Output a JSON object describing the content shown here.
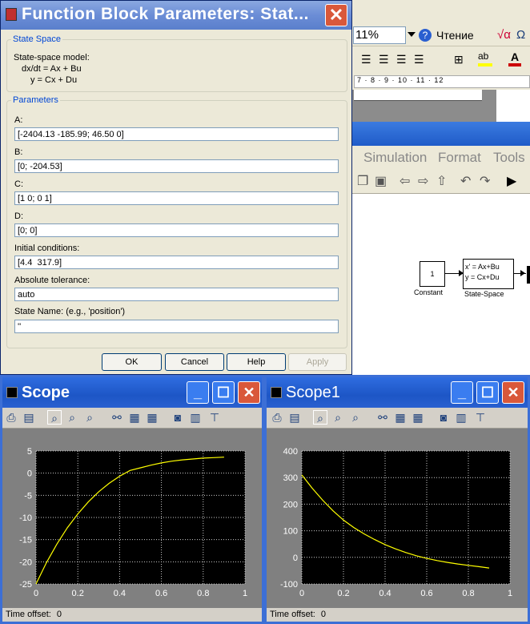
{
  "word": {
    "zoom_value": "11%",
    "reading_label": "Чтение",
    "ruler": "7 · 8 · 9 · 10 · 11 · 12"
  },
  "simulink": {
    "menu": [
      "Simulation",
      "Format",
      "Tools"
    ],
    "constant_block_value": "1",
    "constant_block_label": "Constant",
    "ss_block_line1": "x' = Ax+Bu",
    "ss_block_line2": "y = Cx+Du",
    "ss_block_label": "State-Space"
  },
  "dialog": {
    "title": "Function Block Parameters: Stat...",
    "close_glyph": "✕",
    "state_space_group": "State Space",
    "description": [
      "State-space model:",
      "dx/dt = Ax + Bu",
      "y = Cx + Du"
    ],
    "parameters_group": "Parameters",
    "fields": [
      {
        "label": "A:",
        "value": "[-2404.13 -185.99; 46.50 0]"
      },
      {
        "label": "B:",
        "value": "[0; -204.53]"
      },
      {
        "label": "C:",
        "value": "[1 0; 0 1]"
      },
      {
        "label": "D:",
        "value": "[0; 0]"
      },
      {
        "label": "Initial conditions:",
        "value": "[4.4  317.9]"
      },
      {
        "label": "Absolute tolerance:",
        "value": "auto"
      },
      {
        "label": "State Name: (e.g., 'position')",
        "value": "''"
      }
    ],
    "buttons": {
      "ok": "OK",
      "cancel": "Cancel",
      "help": "Help",
      "apply": "Apply"
    }
  },
  "scopes": [
    {
      "title": "Scope",
      "time_offset_label": "Time offset:",
      "time_offset_value": "0",
      "minimize_glyph": "_",
      "maximize_glyph": "☐",
      "close_glyph": "✕"
    },
    {
      "title": "Scope1",
      "time_offset_label": "Time offset:",
      "time_offset_value": "0",
      "minimize_glyph": "_",
      "maximize_glyph": "☐",
      "close_glyph": "✕"
    }
  ],
  "chart_data": [
    {
      "type": "line",
      "xlim": [
        0,
        1
      ],
      "ylim": [
        -25,
        5
      ],
      "xticks": [
        0,
        0.2,
        0.4,
        0.6,
        0.8,
        1
      ],
      "yticks": [
        5,
        0,
        -5,
        -10,
        -15,
        -20,
        -25
      ],
      "xtick_labels": [
        "0",
        "0.2",
        "0.4",
        "0.6",
        "0.8",
        "1"
      ],
      "ytick_labels": [
        "5",
        "0",
        "-5",
        "-10",
        "-15",
        "-20",
        "-25"
      ],
      "grid": true,
      "line_color": "#ffff00",
      "x": [
        0,
        0.05,
        0.1,
        0.15,
        0.2,
        0.25,
        0.3,
        0.35,
        0.4,
        0.45,
        0.5,
        0.55,
        0.6,
        0.65,
        0.7,
        0.75,
        0.8,
        0.85,
        0.9
      ],
      "y": [
        -25.0,
        -20.2,
        -16.0,
        -12.3,
        -9.2,
        -6.5,
        -4.2,
        -2.3,
        -0.7,
        0.6,
        1.2,
        1.8,
        2.3,
        2.7,
        3.0,
        3.2,
        3.4,
        3.5,
        3.6
      ]
    },
    {
      "type": "line",
      "xlim": [
        0,
        1
      ],
      "ylim": [
        -100,
        400
      ],
      "xticks": [
        0,
        0.2,
        0.4,
        0.6,
        0.8,
        1
      ],
      "yticks": [
        400,
        300,
        200,
        100,
        0,
        -100
      ],
      "xtick_labels": [
        "0",
        "0.2",
        "0.4",
        "0.6",
        "0.8",
        "1"
      ],
      "ytick_labels": [
        "400",
        "300",
        "200",
        "100",
        "0",
        "-100"
      ],
      "grid": true,
      "line_color": "#ffff00",
      "x": [
        0,
        0.05,
        0.1,
        0.15,
        0.2,
        0.25,
        0.3,
        0.35,
        0.4,
        0.45,
        0.5,
        0.55,
        0.6,
        0.65,
        0.7,
        0.75,
        0.8,
        0.85,
        0.9
      ],
      "y": [
        310,
        260,
        215,
        175,
        140,
        112,
        88,
        67,
        48,
        32,
        18,
        6,
        -4,
        -12,
        -19,
        -25,
        -30,
        -35,
        -40
      ]
    }
  ]
}
